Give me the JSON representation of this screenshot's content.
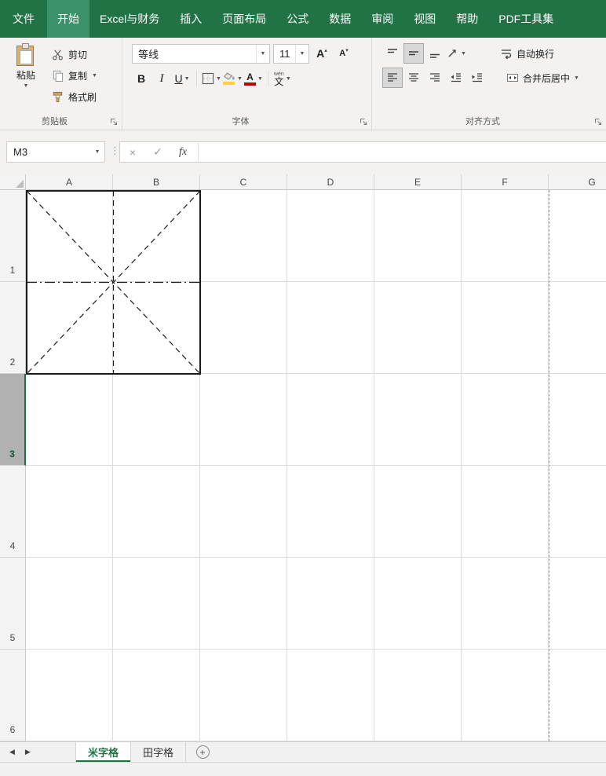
{
  "colors": {
    "excel_green": "#217346",
    "active_tab_green": "#3b9268",
    "fill_color_yellow": "#ffd43b",
    "font_color_red": "#c00000",
    "selection_green": "#1e7145",
    "ribbon_bg": "#f3f2f1"
  },
  "icons": {
    "dropdown_caret": "▼",
    "nav_left": "◀",
    "nav_right": "▶",
    "drag_dots": "⋮",
    "font_grow_caret": "▴",
    "font_shrink_caret": "▾",
    "letter_a": "A"
  },
  "ribbon_tabs": {
    "active_tab": "开始",
    "items": [
      "文件",
      "开始",
      "Excel与财务",
      "插入",
      "页面布局",
      "公式",
      "数据",
      "审阅",
      "视图",
      "帮助",
      "PDF工具集"
    ]
  },
  "clipboard_group": {
    "label": "剪贴板",
    "paste": "粘贴",
    "cut": "剪切",
    "copy": "复制",
    "format_painter": "格式刷"
  },
  "font_group": {
    "label": "字体",
    "font_name": "等线",
    "font_size": "11",
    "bold": "B",
    "italic": "I",
    "underline": "U",
    "phonetic_char": "文",
    "phonetic_hint": "wén"
  },
  "alignment_group": {
    "label": "对齐方式",
    "wrap_text": "自动换行",
    "merge_center": "合并后居中"
  },
  "formula_bar": {
    "name_box": "M3",
    "cancel": "×",
    "enter": "✓",
    "fx": "fx",
    "formula": ""
  },
  "grid": {
    "columns": [
      "A",
      "B",
      "C",
      "D",
      "E",
      "F",
      "G"
    ],
    "rows": [
      "1",
      "2",
      "3",
      "4",
      "5",
      "6"
    ],
    "selected_cell": "M3",
    "selected_row": "3"
  },
  "shape": {
    "name": "米字格",
    "range": "A1:B2"
  },
  "sheet_tabs": {
    "active": "米字格",
    "tabs": [
      "米字格",
      "田字格"
    ],
    "add_label": "+"
  }
}
